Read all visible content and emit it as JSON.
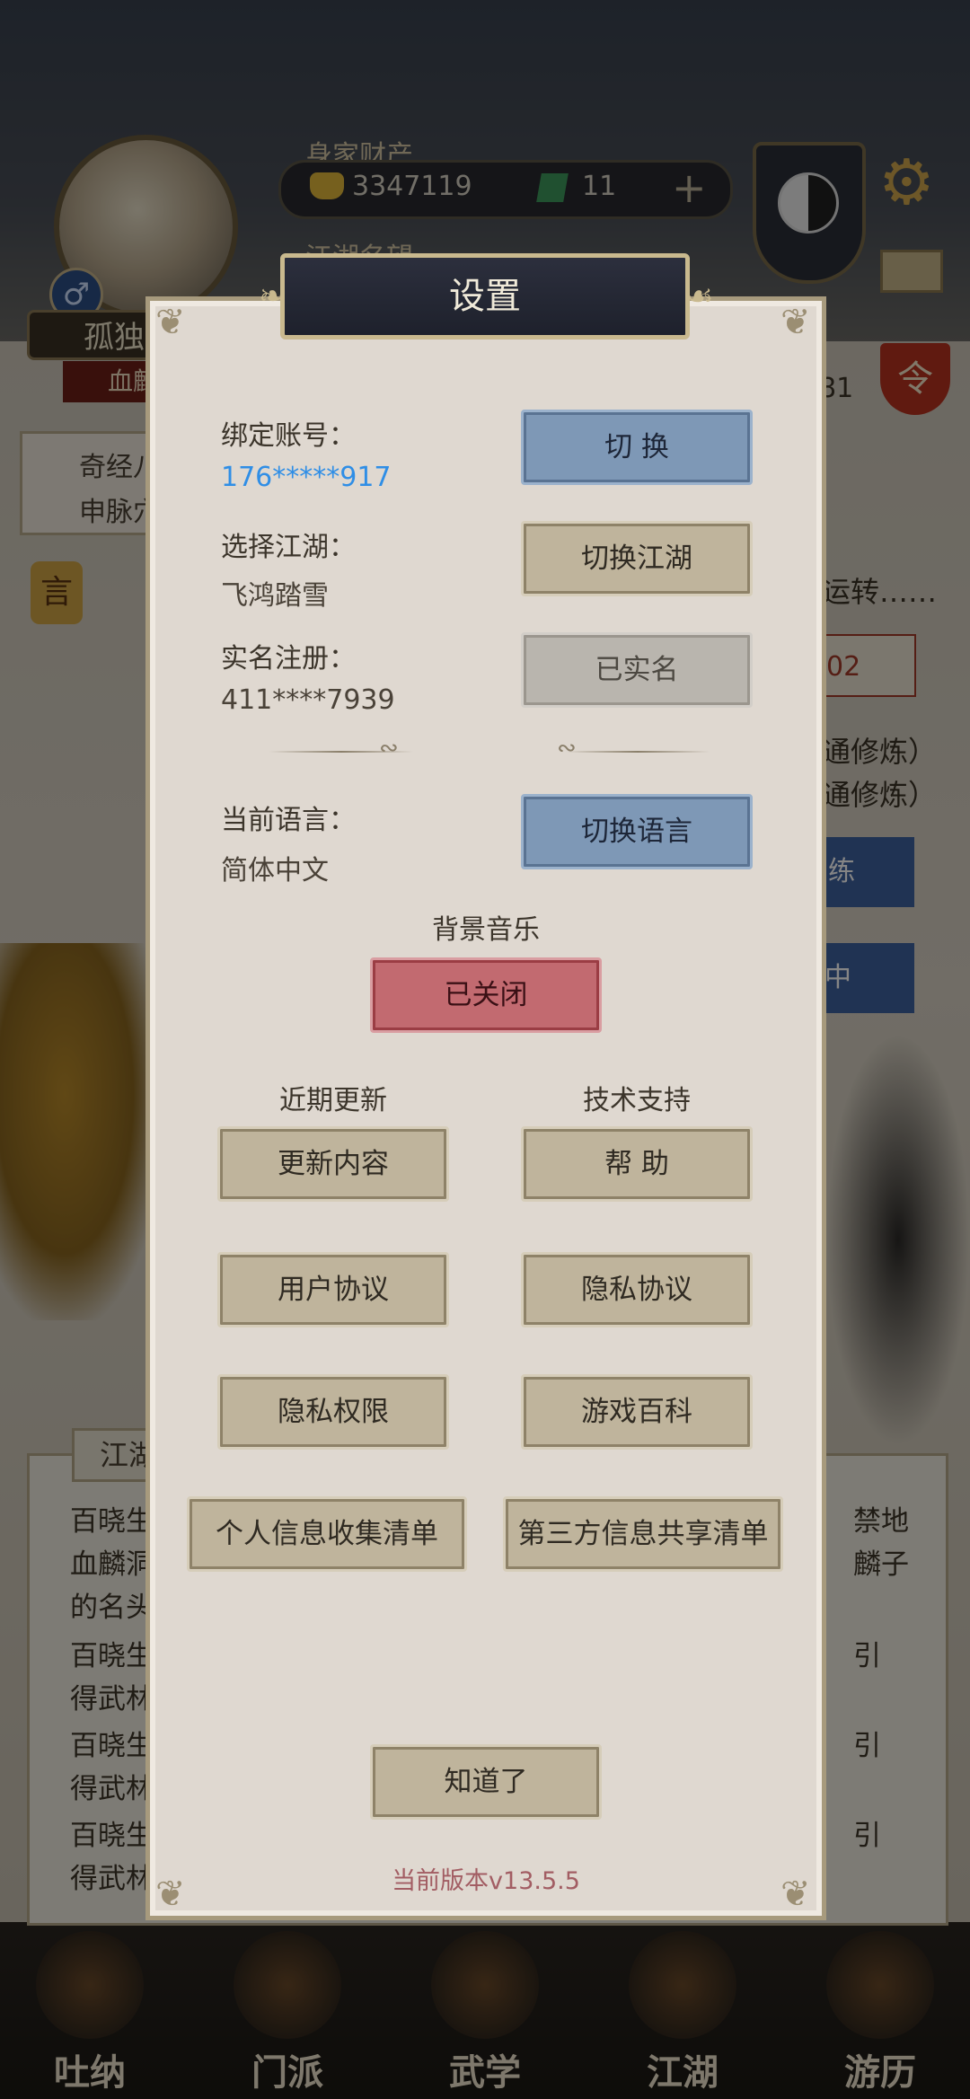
{
  "header": {
    "wealth_label": "身家财产",
    "gold": "3347119",
    "jade": "11",
    "plus": "+",
    "fame_label": "江湖名望",
    "name": "孤独",
    "sub": "血麒",
    "gender_symbol": "♂",
    "ling_badge": "令",
    "bg_number": "81"
  },
  "background": {
    "peek_left_1": "奇经八",
    "peek_left_2": "申脉穴",
    "yan_badge": "言",
    "peek_right_1": "运转……",
    "peek_right_2": "02",
    "peek_right_3": "通修炼）",
    "peek_right_4": "通修炼）",
    "peek_right_5": "练",
    "peek_right_6": "中",
    "news_tab": "江湖",
    "news": [
      "百晓生",
      "血麟洞",
      "的名头",
      "百晓生",
      "得武林",
      "百晓生",
      "得武林",
      "百晓生",
      "得武林"
    ],
    "news_right": [
      "禁地",
      "麟子",
      "引",
      "引",
      "引"
    ]
  },
  "nav": [
    {
      "label": "吐纳"
    },
    {
      "label": "门派"
    },
    {
      "label": "武学"
    },
    {
      "label": "江湖"
    },
    {
      "label": "游历"
    }
  ],
  "dialog": {
    "title": "设置",
    "bind_label": "绑定账号：",
    "bind_value": "176*****917",
    "bind_button": "切 换",
    "jianghu_label": "选择江湖：",
    "jianghu_value": "飞鸿踏雪",
    "jianghu_button": "切换江湖",
    "realname_label": "实名注册：",
    "realname_value": "411****7939",
    "realname_button": "已实名",
    "lang_label": "当前语言：",
    "lang_value": "简体中文",
    "lang_button": "切换语言",
    "music_label": "背景音乐",
    "music_button": "已关闭",
    "updates_label": "近期更新",
    "support_label": "技术支持",
    "update_content_button": "更新内容",
    "help_button": "帮 助",
    "user_agreement_button": "用户协议",
    "privacy_agreement_button": "隐私协议",
    "privacy_permission_button": "隐私权限",
    "wiki_button": "游戏百科",
    "personal_info_button": "个人信息收集清单",
    "third_party_button": "第三方信息共享清单",
    "ok_button": "知道了",
    "version": "当前版本v13.5.5"
  }
}
